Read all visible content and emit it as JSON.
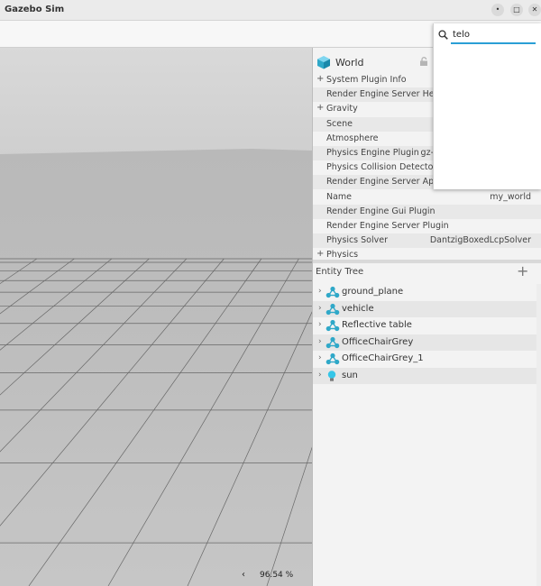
{
  "window": {
    "title": "Gazebo Sim",
    "min_glyph": "•",
    "max_glyph": "□",
    "close_glyph": "✕"
  },
  "component_inspector": {
    "entity_name": "World",
    "entity_icon": "cube-icon",
    "lock_icon": "lock-icon",
    "properties": [
      {
        "expand": "+",
        "label": "System Plugin Info",
        "value": ""
      },
      {
        "expand": "",
        "label": "Render Engine Server Headless",
        "value": ""
      },
      {
        "expand": "+",
        "label": "Gravity",
        "value": ""
      },
      {
        "expand": "",
        "label": "Scene",
        "value": ""
      },
      {
        "expand": "",
        "label": "Atmosphere",
        "value": ""
      },
      {
        "expand": "",
        "label": "Physics Engine Plugin",
        "value": "gz-physics-dartsim-plugin"
      },
      {
        "expand": "",
        "label": "Physics Collision Detector",
        "value": ""
      },
      {
        "expand": "",
        "label": "Render Engine Server Api Backend",
        "value": ""
      },
      {
        "expand": "",
        "label": "Name",
        "value": "my_world"
      },
      {
        "expand": "",
        "label": "Render Engine Gui Plugin",
        "value": ""
      },
      {
        "expand": "",
        "label": "Render Engine Server Plugin",
        "value": ""
      },
      {
        "expand": "",
        "label": "Physics Solver",
        "value": "DantzigBoxedLcpSolver"
      },
      {
        "expand": "+",
        "label": "Physics",
        "value": ""
      }
    ]
  },
  "entity_tree": {
    "title": "Entity Tree",
    "add_glyph": "+",
    "chevron": "›",
    "items": [
      {
        "name": "ground_plane",
        "icon": "model-icon"
      },
      {
        "name": "vehicle",
        "icon": "model-icon"
      },
      {
        "name": "Reflective table",
        "icon": "model-icon"
      },
      {
        "name": "OfficeChairGrey",
        "icon": "model-icon"
      },
      {
        "name": "OfficeChairGrey_1",
        "icon": "model-icon"
      },
      {
        "name": "sun",
        "icon": "light-bulb-icon"
      }
    ]
  },
  "plugin_search": {
    "query": "telo",
    "icon": "search-icon"
  },
  "viewport": {
    "real_time_factor": "96.54 %",
    "rtf_arrow": "‹"
  },
  "colors": {
    "accent": "#2a9fd6",
    "model_icon": "#2fa8c8",
    "light_icon": "#35c6e8"
  }
}
